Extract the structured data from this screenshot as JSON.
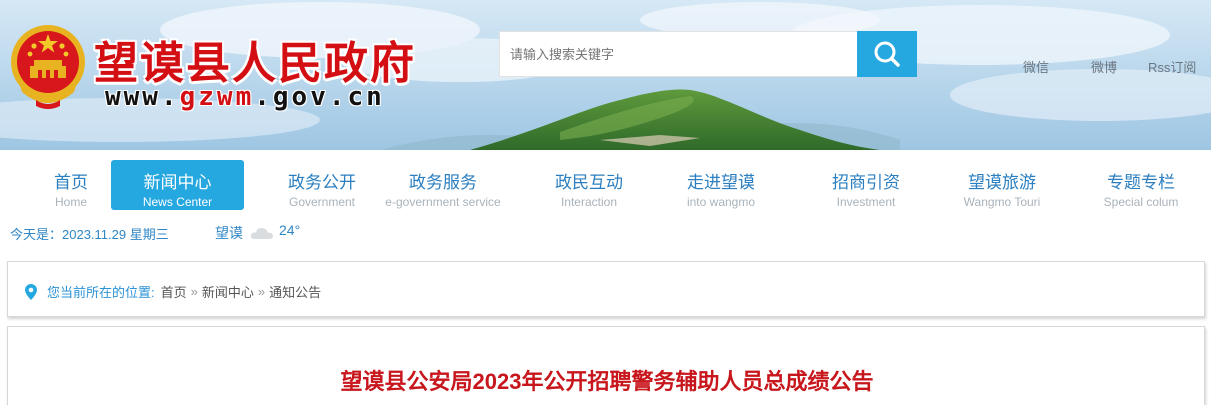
{
  "header": {
    "site_title": "望谟县人民政府",
    "url_prefix": "www.",
    "url_domain": "gzwm",
    "url_suffix": ".gov.cn",
    "search_placeholder": "请输入搜索关键字",
    "links": {
      "wechat": "微信",
      "weibo": "微博",
      "rss": "Rss订阅"
    }
  },
  "nav": {
    "items": [
      {
        "zh": "首页",
        "en": "Home"
      },
      {
        "zh": "新闻中心",
        "en": "News Center"
      },
      {
        "zh": "政务公开",
        "en": "Government"
      },
      {
        "zh": "政务服务",
        "en": "e-government service"
      },
      {
        "zh": "政民互动",
        "en": "Interaction"
      },
      {
        "zh": "走进望谟",
        "en": "into wangmo"
      },
      {
        "zh": "招商引资",
        "en": "Investment"
      },
      {
        "zh": "望谟旅游",
        "en": "Wangmo Touri"
      },
      {
        "zh": "专题专栏",
        "en": "Special colum"
      }
    ],
    "active_index": 1
  },
  "info": {
    "date_text": "今天是：2023.11.29 星期三",
    "city": "望谟",
    "temperature": "24°"
  },
  "breadcrumb": {
    "lead": "您当前所在的位置:",
    "items": [
      "首页",
      "新闻中心",
      "通知公告"
    ],
    "separator": "»"
  },
  "article": {
    "title": "望谟县公安局2023年公开招聘警务辅助人员总成绩公告"
  },
  "colors": {
    "accent_blue": "#25a7e0",
    "title_red": "#d40f14",
    "nav_text": "#2b7fc0"
  },
  "icons": {
    "search": "search-icon",
    "location": "location-pin-icon",
    "weather": "cloud-icon",
    "emblem": "national-emblem"
  }
}
